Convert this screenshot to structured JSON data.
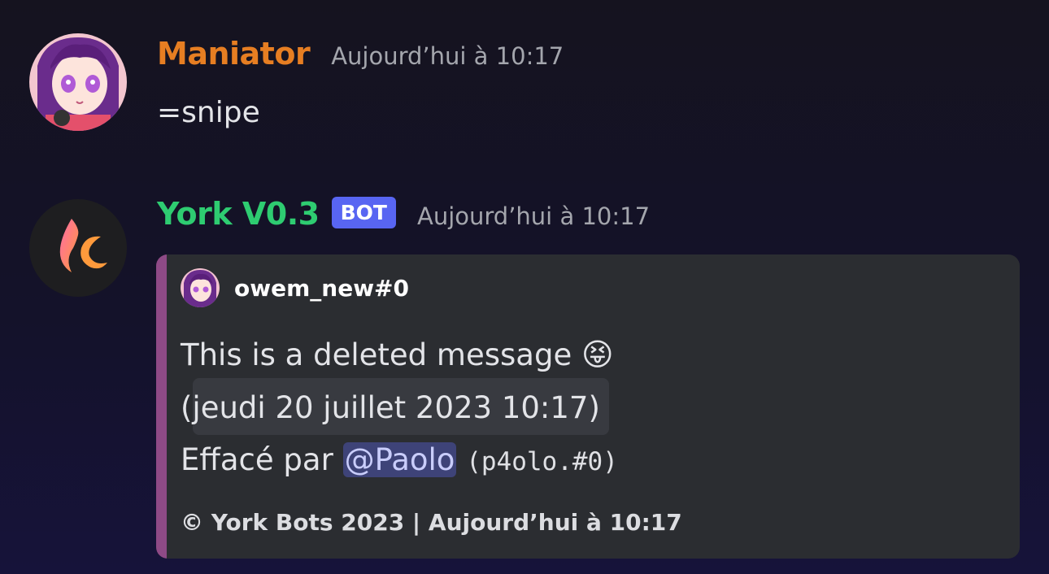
{
  "messages": [
    {
      "author": "Maniator",
      "author_color": "#e67e22",
      "timestamp": "Aujourd’hui à 10:17",
      "content": "=snipe"
    },
    {
      "author": "York V0.3",
      "author_color": "#2ecc71",
      "badge": "BOT",
      "timestamp": "Aujourd’hui à 10:17",
      "embed": {
        "accent_color": "#8e4a86",
        "author_name": "owem_new#0",
        "description_line1": "This is a deleted message",
        "emoji": "😝",
        "date_line": "(jeudi 20 juillet 2023 10:17)",
        "deleted_by_label": "Effacé par",
        "mention": "@Paolo",
        "user_tag": "(p4olo.#0)",
        "footer": "© York Bots 2023 | Aujourd’hui à 10:17"
      }
    }
  ]
}
